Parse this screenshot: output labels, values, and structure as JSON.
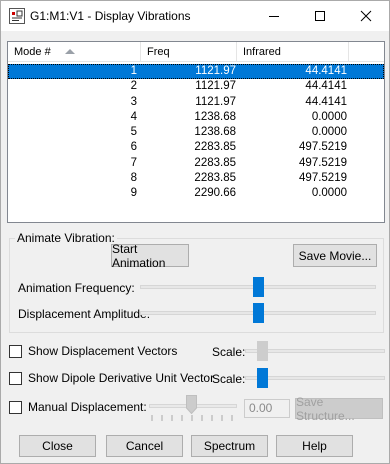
{
  "window": {
    "title": "G1:M1:V1 - Display Vibrations"
  },
  "list": {
    "columns": [
      "Mode #",
      "Freq",
      "Infrared"
    ],
    "rows": [
      {
        "mode": "1",
        "freq": "1121.97",
        "ir": "44.4141",
        "selected": true
      },
      {
        "mode": "2",
        "freq": "1121.97",
        "ir": "44.4141"
      },
      {
        "mode": "3",
        "freq": "1121.97",
        "ir": "44.4141"
      },
      {
        "mode": "4",
        "freq": "1238.68",
        "ir": "0.0000"
      },
      {
        "mode": "5",
        "freq": "1238.68",
        "ir": "0.0000"
      },
      {
        "mode": "6",
        "freq": "2283.85",
        "ir": "497.5219"
      },
      {
        "mode": "7",
        "freq": "2283.85",
        "ir": "497.5219"
      },
      {
        "mode": "8",
        "freq": "2283.85",
        "ir": "497.5219"
      },
      {
        "mode": "9",
        "freq": "2290.66",
        "ir": "0.0000"
      }
    ]
  },
  "animate": {
    "group_label": "Animate Vibration:",
    "start_label": "Start Animation",
    "save_movie_label": "Save Movie...",
    "frequency_label": "Animation Frequency:",
    "amplitude_label": "Displacement Amplitude:",
    "frequency_level": 0.5,
    "amplitude_level": 0.5
  },
  "options": {
    "displacement_vectors_label": "Show Displacement Vectors",
    "dipole_vector_label": "Show Dipole Derivative Unit Vector",
    "manual_displacement_label": "Manual Displacement:",
    "scale_label": "Scale:",
    "manual_value": "0.00",
    "save_structure_label": "Save Structure...",
    "displacement_vectors_checked": false,
    "dipole_vector_checked": false,
    "manual_displacement_checked": false
  },
  "footer": {
    "close_label": "Close",
    "cancel_label": "Cancel",
    "spectrum_label": "Spectrum",
    "help_label": "Help"
  },
  "colors": {
    "accent": "#0078d7",
    "selection": "#0078d7"
  }
}
